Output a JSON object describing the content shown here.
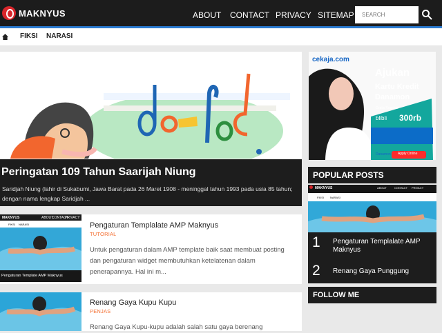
{
  "site": {
    "brand": "MAKNYUS"
  },
  "nav": {
    "items": [
      "ABOUT",
      "CONTACT",
      "PRIVACY",
      "SITEMAP"
    ]
  },
  "search": {
    "placeholder": "SEARCH"
  },
  "secondary_nav": {
    "items": [
      "FIKSI",
      "NARASI"
    ]
  },
  "featured": {
    "title": "Peringatan 109 Tahun Saarijah Niung",
    "description": "Saridjah Niung (lahir di Sukabumi, Jawa Barat pada 26 Maret 1908 - meninggal tahun 1993 pada usia 85 tahun; dengan nama lengkap Saridjah ..."
  },
  "posts": [
    {
      "title": "Pengaturan Templalate AMP Maknyus",
      "category": "TUTORIAL",
      "text": "Untuk pengaturan dalam AMP template baik saat membuat posting dan pengaturan widget membutuhkan ketelatenan dalam penerapannya. Hal ini m...",
      "thumb_caption": "Pengaturan Template AMP Maknyus"
    },
    {
      "title": "Renang Gaya Kupu Kupu",
      "category": "PENJAS",
      "text": "Renang Gaya Kupu-kupu adalah salah satu gaya berenang"
    }
  ],
  "ad": {
    "logo": "cekaja.com",
    "headline1": "Ajukan",
    "headline2": "Kartu Kredit",
    "headline3": "Danamon",
    "small": "Gratis Voucher",
    "brand": "blibli",
    "price": "300rb",
    "button": "Apply Online",
    "bank": "Danamon"
  },
  "sidebar": {
    "popular_title": "POPULAR POSTS",
    "mini_brand": "MAKNYUS",
    "mini_nav": [
      "ABOUT",
      "CONTACT",
      "PRIVACY"
    ],
    "mini_secondary": [
      "FIKSI",
      "NARASI"
    ],
    "popular": [
      {
        "rank": "1",
        "title": "Pengaturan Templalate AMP Maknyus"
      },
      {
        "rank": "2",
        "title": "Renang Gaya Punggung"
      }
    ],
    "follow_title": "FOLLOW ME"
  },
  "colors": {
    "topbar": "#1c1c1c",
    "accent": "#2b7bd1",
    "category": "#f36f32",
    "logo": "#d8262b"
  }
}
